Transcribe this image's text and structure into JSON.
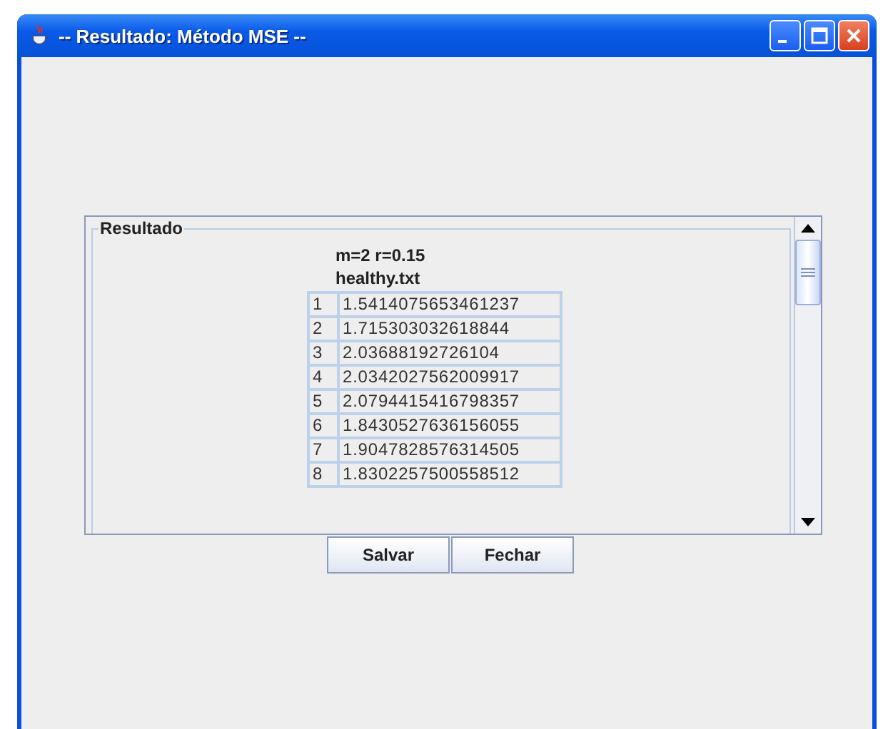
{
  "window": {
    "title": "-- Resultado: Método MSE --"
  },
  "panel": {
    "title": "Resultado",
    "header_line_1": "m=2  r=0.15",
    "header_line_2": "healthy.txt",
    "rows": [
      [
        "1",
        "1.5414075653461237"
      ],
      [
        "2",
        "1.715303032618844"
      ],
      [
        "3",
        "2.03688192726104"
      ],
      [
        "4",
        "2.0342027562009917"
      ],
      [
        "5",
        "2.0794415416798357"
      ],
      [
        "6",
        "1.8430527636156055"
      ],
      [
        "7",
        "1.9047828576314505"
      ],
      [
        "8",
        "1.8302257500558512"
      ]
    ]
  },
  "buttons": [
    "Salvar",
    "Fechar"
  ]
}
